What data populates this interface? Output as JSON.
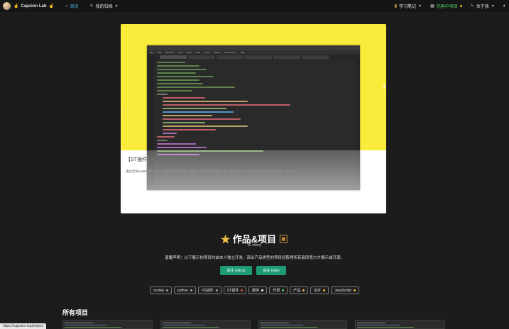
{
  "navbar": {
    "brand": "Capsion Lab",
    "items": [
      {
        "label": "首页",
        "icon": "home-icon",
        "active": true
      },
      {
        "label": "我的归档",
        "icon": "wand-icon",
        "dropdown": true
      }
    ],
    "right": [
      {
        "label": "学习笔记",
        "icon": "book-icon",
        "dropdown": true
      },
      {
        "label": "完善中项目",
        "icon": "building-icon"
      },
      {
        "label": "关于我",
        "icon": "wand-icon",
        "dropdown": true
      }
    ]
  },
  "hero": {
    "caption_title": "【ST插件】代码格式化",
    "caption_desc": "通过全局node库和 prettier 插件格式化文件，支持一下类型格式文件：js、html、css、png、stylus、less、sass、scss、ts",
    "editor_menu": [
      "File",
      "Edit",
      "Selection",
      "Find",
      "View",
      "Goto",
      "Tools",
      "Project",
      "Preferences",
      "Help"
    ]
  },
  "projects": {
    "title": "作品&项目",
    "count": "(6 sites)",
    "note": "温馨声明：以下展示的项目均由本人独立开发，商业产品类型的项目经取得所有者同意方才展示或开源。",
    "buttons": [
      {
        "label": "前往 Github"
      },
      {
        "label": "前往 Gitee"
      }
    ],
    "tags": [
      {
        "label": "nodejs",
        "color": "#a0a0a0"
      },
      {
        "label": "python",
        "color": "#a0a0a0"
      },
      {
        "label": "VS插件",
        "color": "#a0a0a0"
      },
      {
        "label": "ST插件",
        "color": "#e04b4b"
      },
      {
        "label": "服务",
        "color": "#ffffff"
      },
      {
        "label": "开源",
        "color": "#4ed36a"
      },
      {
        "label": "产品",
        "color": "#f0c040"
      },
      {
        "label": "设计",
        "color": "#f0c040"
      },
      {
        "label": "JavaScript",
        "color": "#f0c040"
      }
    ]
  },
  "all_projects": {
    "title": "所有项目"
  },
  "status_url": "https://capsion.top/project"
}
